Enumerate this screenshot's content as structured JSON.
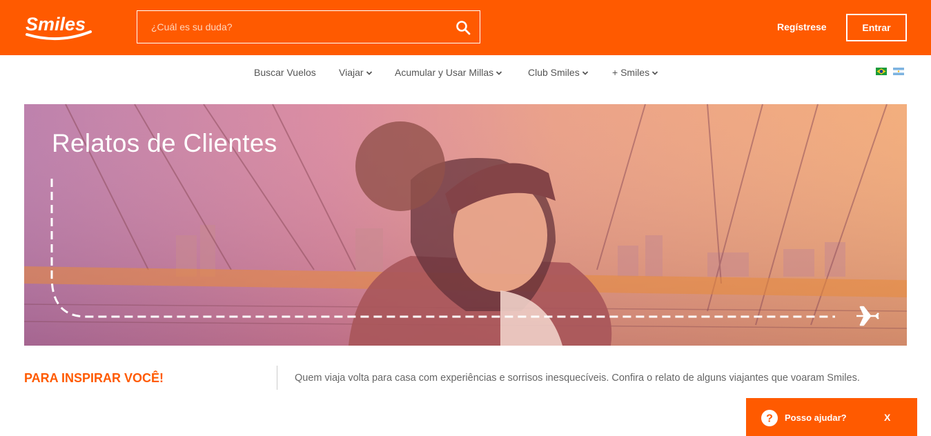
{
  "header": {
    "logo_text": "Smiles",
    "search": {
      "placeholder": "¿Cuál es su duda?",
      "icon": "search-icon"
    },
    "register_label": "Regístrese",
    "login_label": "Entrar"
  },
  "nav": {
    "items": [
      {
        "label": "Buscar Vuelos",
        "has_dropdown": false
      },
      {
        "label": "Viajar",
        "has_dropdown": true
      },
      {
        "label": "Acumular y Usar Millas",
        "has_dropdown": true
      },
      {
        "label": "Club Smiles",
        "has_dropdown": true
      },
      {
        "label": "+ Smiles",
        "has_dropdown": true
      }
    ],
    "flags": [
      "brazil-flag-icon",
      "argentina-flag-icon"
    ]
  },
  "hero": {
    "title": "Relatos de Clientes",
    "icon": "airplane-icon"
  },
  "intro": {
    "title": "PARA INSPIRAR VOCÊ!",
    "text": "Quem viaja volta para casa com experiências e sorrisos inesquecíveis. Confira o relato de alguns viajantes que voaram Smiles."
  },
  "help_widget": {
    "label": "Posso ajudar?",
    "close": "X",
    "icon": "question-icon"
  },
  "colors": {
    "brand_orange": "#ff5a00",
    "text_gray": "#555555"
  }
}
